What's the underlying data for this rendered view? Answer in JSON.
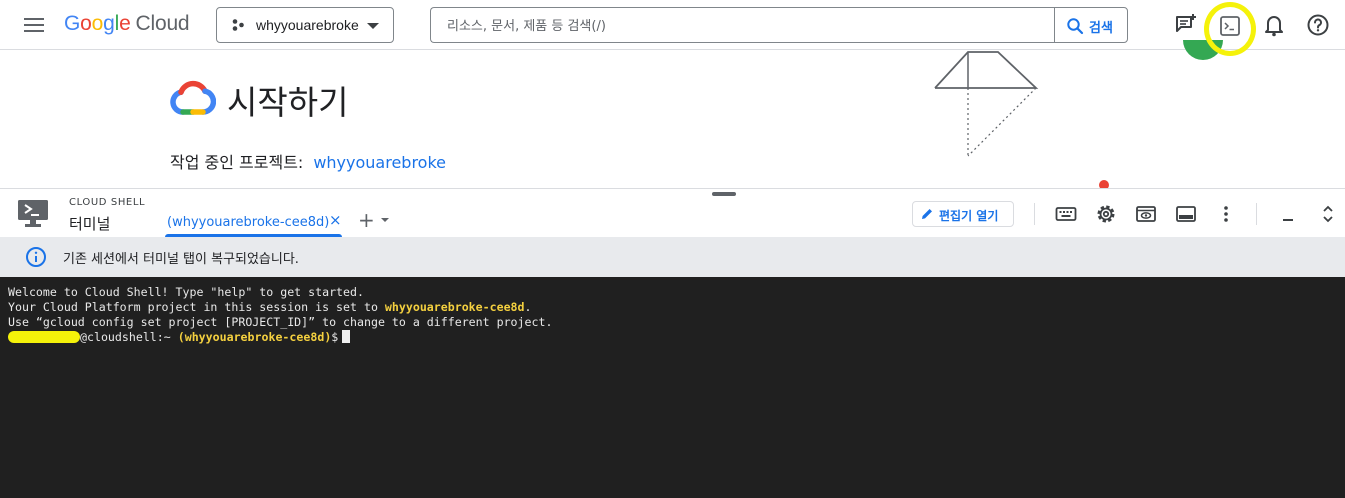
{
  "topbar": {
    "logo": {
      "google_letters": [
        "G",
        "o",
        "o",
        "g",
        "l",
        "e"
      ],
      "cloud": "Cloud"
    },
    "project_picker": {
      "label": "whyyouarebroke",
      "icon": "project-dots-icon"
    },
    "search": {
      "placeholder": "리소스, 문서, 제품 등 검색(/)",
      "value": "",
      "button_label": "검색"
    },
    "icons": [
      "notes-add-icon",
      "cloud-shell-terminal-icon",
      "bell-icon",
      "help-icon"
    ],
    "highlight_color": "#f5f20a"
  },
  "main": {
    "title": "시작하기",
    "project_label": "작업 중인 프로젝트:",
    "project_link": "whyyouarebroke"
  },
  "shell": {
    "kicker": "CLOUD SHELL",
    "title": "터미널",
    "tab_label": "(whyyouarebroke-cee8d)",
    "tab_close": "×",
    "add_tab": "+",
    "editor_button": "편집기 열기",
    "tools": [
      "keyboard-icon",
      "settings-gear-icon",
      "web-preview-icon",
      "layout-icon",
      "more-vert-icon",
      "minimize-icon",
      "expand-collapse-icon"
    ]
  },
  "banner": {
    "text": "기존 세션에서 터미널 탭이 복구되었습니다."
  },
  "terminal": {
    "line1": "Welcome to Cloud Shell! Type \"help\" to get started.",
    "line2_prefix": "Your Cloud Platform project in this session is set to ",
    "line2_project": "whyyouarebroke-cee8d",
    "line2_suffix": ".",
    "line3": "Use “gcloud config set project [PROJECT_ID]” to change to a different project.",
    "prompt_host": "@cloudshell:~",
    "prompt_project": "(whyyouarebroke-cee8d)",
    "prompt_symbol": "$",
    "colors": {
      "background": "#202020",
      "highlight": "#f4d03f"
    }
  },
  "colors": {
    "accent": "#1a73e8",
    "border": "#dadce0",
    "banner_bg": "#e8eaed"
  }
}
